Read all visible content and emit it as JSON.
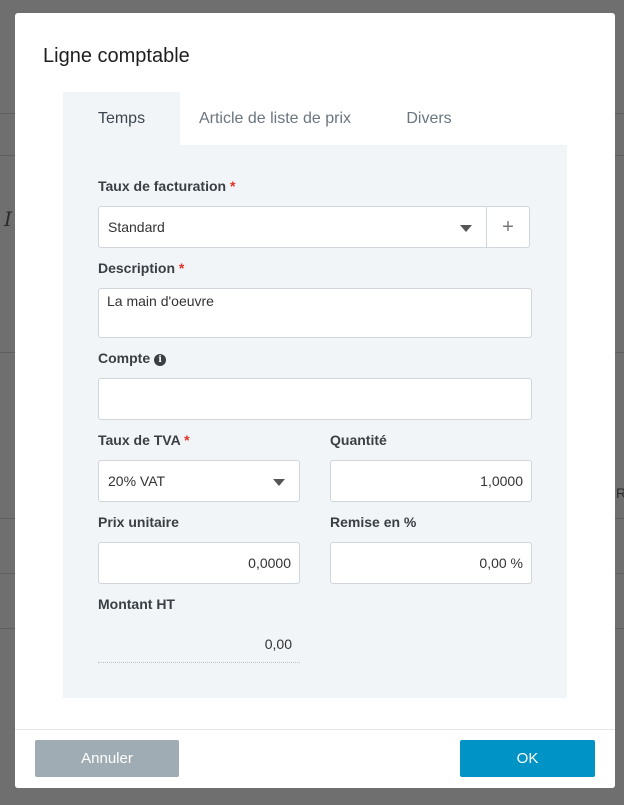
{
  "background": {
    "glyph": "I",
    "side_letter": "R"
  },
  "dialog": {
    "title": "Ligne comptable",
    "tabs": [
      {
        "label": "Temps",
        "active": true
      },
      {
        "label": "Article de liste de prix",
        "active": false
      },
      {
        "label": "Divers",
        "active": false
      }
    ]
  },
  "form": {
    "billing_rate": {
      "label": "Taux de facturation",
      "required": "*",
      "value": "Standard",
      "add_symbol": "+"
    },
    "description": {
      "label": "Description",
      "required": "*",
      "value": "La main d'oeuvre"
    },
    "account": {
      "label": "Compte",
      "value": "",
      "info_icon": "info-icon"
    },
    "vat_rate": {
      "label": "Taux de TVA",
      "required": "*",
      "value": "20% VAT"
    },
    "quantity": {
      "label": "Quantité",
      "value": "1,0000"
    },
    "unit_price": {
      "label": "Prix unitaire",
      "value": "0,0000"
    },
    "discount": {
      "label": "Remise en %",
      "value": "0,00 %"
    },
    "amount_ht": {
      "label": "Montant HT",
      "value": "0,00"
    }
  },
  "footer": {
    "cancel_label": "Annuler",
    "ok_label": "OK"
  },
  "colors": {
    "ok_button": "#0094c6",
    "cancel_button": "#a0acb4",
    "required": "#e0322b",
    "panel_bg": "#f1f5f7"
  }
}
